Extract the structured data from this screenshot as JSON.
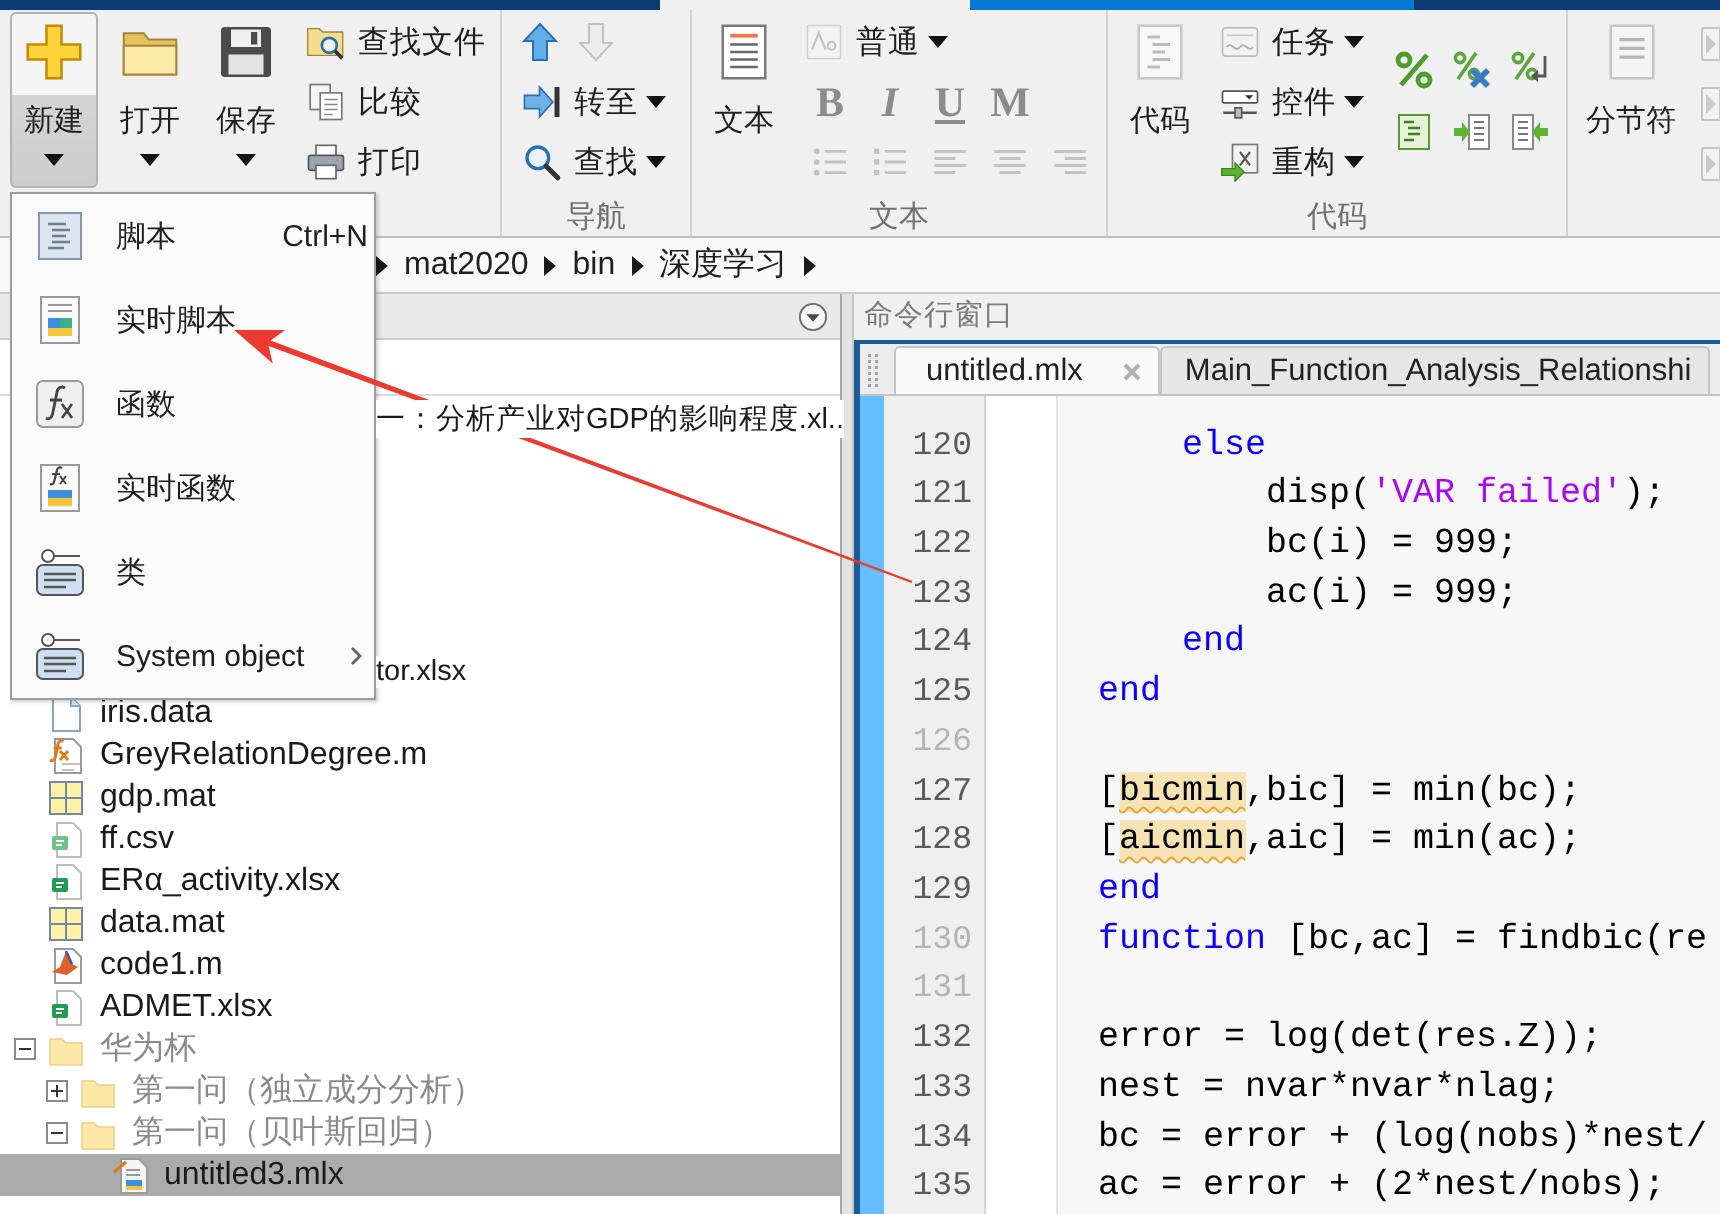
{
  "toolstrip": {
    "file": {
      "new": {
        "label": "新建",
        "pressed": true
      },
      "open": {
        "label": "打开",
        "pressed": false
      },
      "save": {
        "label": "保存",
        "pressed": false
      },
      "find_files": {
        "label": "查找文件"
      },
      "compare": {
        "label": "比较"
      },
      "print": {
        "label": "打印"
      }
    },
    "navigate": {
      "title": "导航",
      "up_arrow": {
        "disabled": false
      },
      "down_arrow": {
        "disabled": true
      },
      "go_to": {
        "label": "转至"
      },
      "find": {
        "label": "查找"
      }
    },
    "text": {
      "title": "文本",
      "text_button": {
        "label": "文本"
      },
      "style_dropdown": {
        "value": "普通"
      },
      "format_buttons": [
        {
          "label": "B",
          "kind": "bold",
          "disabled": true
        },
        {
          "label": "I",
          "kind": "italic",
          "disabled": true
        },
        {
          "label": "U",
          "kind": "underline",
          "disabled": true
        },
        {
          "label": "M",
          "kind": "monospace",
          "disabled": true
        }
      ],
      "paragraph_buttons": [
        {
          "kind": "bullets",
          "disabled": true
        },
        {
          "kind": "numbered",
          "disabled": true
        },
        {
          "kind": "align-left",
          "disabled": true
        },
        {
          "kind": "align-center",
          "disabled": true
        },
        {
          "kind": "align-right",
          "disabled": true
        }
      ]
    },
    "code": {
      "title": "代码",
      "code_button": {
        "label": "代码"
      },
      "task": {
        "label": "任务"
      },
      "control": {
        "label": "控件"
      },
      "refactor": {
        "label": "重构"
      }
    },
    "section": {
      "section_break": {
        "label": "分节符"
      }
    }
  },
  "new_menu": {
    "items": [
      {
        "label": "脚本",
        "kind": "script",
        "shortcut": "Ctrl+N",
        "submenu": false
      },
      {
        "label": "实时脚本",
        "kind": "live-script",
        "submenu": false
      },
      {
        "label": "函数",
        "kind": "function",
        "submenu": false
      },
      {
        "label": "实时函数",
        "kind": "live-function",
        "submenu": false
      },
      {
        "label": "类",
        "kind": "class",
        "submenu": false
      },
      {
        "label": "System object",
        "kind": "system-object",
        "submenu": true
      }
    ]
  },
  "address_bar": {
    "path": [
      "mat2020",
      "bin",
      "深度学习"
    ]
  },
  "current_folder": {
    "covered_rows": [
      "一：分析产业对GDP的影响程度.xl..",
      "tor.xlsx"
    ],
    "tree": [
      {
        "label": "iris.data",
        "kind": "text-file",
        "selected": false
      },
      {
        "label": "GreyRelationDegree.m",
        "kind": "function-file",
        "selected": false
      },
      {
        "label": "gdp.mat",
        "kind": "mat-file",
        "selected": false
      },
      {
        "label": "ff.csv",
        "kind": "csv-file",
        "selected": false
      },
      {
        "label": "ERα_activity.xlsx",
        "kind": "spreadsheet",
        "selected": false
      },
      {
        "label": "data.mat",
        "kind": "mat-file",
        "selected": false
      },
      {
        "label": "code1.m",
        "kind": "script-file",
        "selected": false
      },
      {
        "label": "ADMET.xlsx",
        "kind": "spreadsheet",
        "selected": false
      },
      {
        "label": "华为杯",
        "kind": "folder",
        "expanded": true,
        "selected": false,
        "children": [
          {
            "label": "第一问（独立成分分析）",
            "kind": "folder",
            "expanded": false,
            "selected": false
          },
          {
            "label": "第一问（贝叶斯回归）",
            "kind": "folder",
            "expanded": true,
            "selected": false,
            "children": [
              {
                "label": "untitled3.mlx",
                "kind": "live-script",
                "selected": true
              }
            ]
          }
        ]
      }
    ]
  },
  "editor": {
    "panel_title": "命令行窗口",
    "tabs": [
      {
        "label": "untitled.mlx",
        "selected": true
      },
      {
        "label": "Main_Function_Analysis_Relationshi",
        "selected": false
      }
    ],
    "lines": [
      {
        "number": "120",
        "executable": true,
        "tokens": [
          {
            "kind": "keyword",
            "text": "    else"
          }
        ]
      },
      {
        "number": "121",
        "executable": true,
        "tokens": [
          {
            "kind": "plain",
            "text": "        disp("
          },
          {
            "kind": "string",
            "text": "'VAR failed'"
          },
          {
            "kind": "plain",
            "text": ");"
          }
        ]
      },
      {
        "number": "122",
        "executable": true,
        "tokens": [
          {
            "kind": "plain",
            "text": "        bc(i) = 999;"
          }
        ]
      },
      {
        "number": "123",
        "executable": true,
        "tokens": [
          {
            "kind": "plain",
            "text": "        ac(i) = 999;"
          }
        ]
      },
      {
        "number": "124",
        "executable": true,
        "tokens": [
          {
            "kind": "keyword",
            "text": "    end"
          }
        ]
      },
      {
        "number": "125",
        "executable": true,
        "tokens": [
          {
            "kind": "keyword",
            "text": "end"
          }
        ]
      },
      {
        "number": "126",
        "executable": false
      },
      {
        "number": "127",
        "executable": true,
        "tokens": [
          {
            "kind": "plain",
            "text": "["
          },
          {
            "kind": "warning",
            "text": "bicmin"
          },
          {
            "kind": "plain",
            "text": ",bic] = min(bc);"
          }
        ]
      },
      {
        "number": "128",
        "executable": true,
        "tokens": [
          {
            "kind": "plain",
            "text": "["
          },
          {
            "kind": "warning",
            "text": "aicmin"
          },
          {
            "kind": "plain",
            "text": ",aic] = min(ac);"
          }
        ]
      },
      {
        "number": "129",
        "executable": true,
        "tokens": [
          {
            "kind": "keyword",
            "text": "end"
          }
        ]
      },
      {
        "number": "130",
        "executable": false,
        "tokens": [
          {
            "kind": "keyword",
            "text": "function"
          },
          {
            "kind": "plain",
            "text": " [bc,ac] = findbic(re"
          }
        ]
      },
      {
        "number": "131",
        "executable": false
      },
      {
        "number": "132",
        "executable": true,
        "tokens": [
          {
            "kind": "plain",
            "text": "error = log(det(res.Z));"
          }
        ]
      },
      {
        "number": "133",
        "executable": true,
        "tokens": [
          {
            "kind": "plain",
            "text": "nest = nvar*nvar*nlag;"
          }
        ]
      },
      {
        "number": "134",
        "executable": true,
        "tokens": [
          {
            "kind": "plain",
            "text": "bc = error + (log(nobs)*nest/"
          }
        ]
      },
      {
        "number": "135",
        "executable": true,
        "tokens": [
          {
            "kind": "plain",
            "text": "ac = error + (2*nest/nobs);"
          }
        ]
      }
    ]
  }
}
